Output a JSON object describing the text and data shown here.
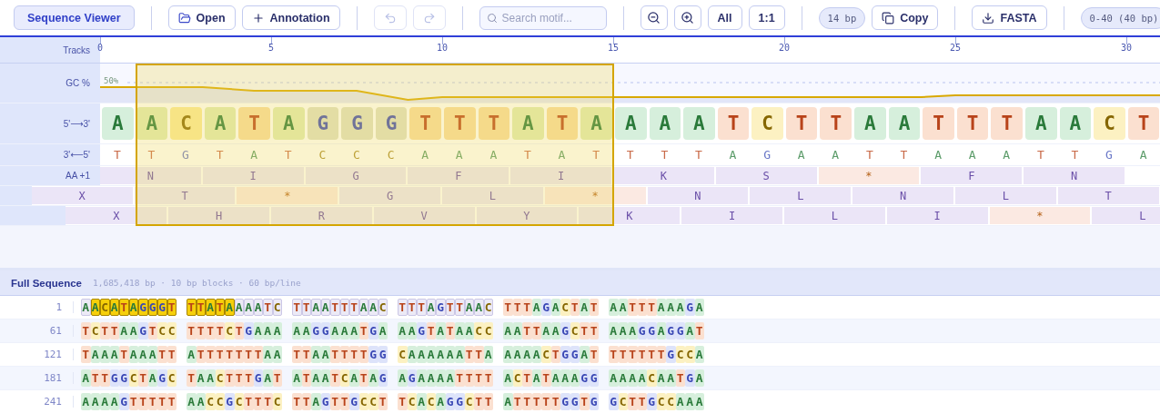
{
  "toolbar": {
    "title": {
      "label": "Sequence Viewer",
      "selected": true
    },
    "file_buttons": [
      {
        "kind": "open",
        "label": "Open"
      },
      {
        "kind": "add",
        "label": "Annotation"
      }
    ],
    "history": [
      {
        "kind": "undo",
        "disabled": true
      },
      {
        "kind": "redo",
        "disabled": true
      }
    ],
    "search": {
      "placeholder": "Search motif..."
    },
    "zoom": [
      {
        "kind": "zoom-out"
      },
      {
        "kind": "zoom-in"
      },
      {
        "kind": "text",
        "label": "All"
      },
      {
        "kind": "text",
        "label": "1:1"
      }
    ],
    "selection_length": "14 bp",
    "copy": "Copy",
    "export": "FASTA",
    "range": "0-40 (40 bp)"
  },
  "tracks": {
    "label": "Tracks",
    "ruler": [
      "0",
      "5",
      "10",
      "15",
      "20",
      "25",
      "30"
    ],
    "gc": {
      "label": "GC %",
      "midline": "50%"
    },
    "forward": {
      "label": "5'⟶3'",
      "bases": [
        {
          "base": "A",
          "selected": false
        },
        {
          "base": "A",
          "selected": true
        },
        {
          "base": "C",
          "selected": true
        },
        {
          "base": "A",
          "selected": true
        },
        {
          "base": "T",
          "selected": true
        },
        {
          "base": "A",
          "selected": true
        },
        {
          "base": "G",
          "selected": true
        },
        {
          "base": "G",
          "selected": true
        },
        {
          "base": "G",
          "selected": true
        },
        {
          "base": "T",
          "selected": true
        },
        {
          "base": "T",
          "selected": true
        },
        {
          "base": "T",
          "selected": true
        },
        {
          "base": "A",
          "selected": true
        },
        {
          "base": "T",
          "selected": true
        },
        {
          "base": "A",
          "selected": true
        },
        {
          "base": "A",
          "selected": false
        },
        {
          "base": "A",
          "selected": false
        },
        {
          "base": "A",
          "selected": false
        },
        {
          "base": "T",
          "selected": false
        },
        {
          "base": "C",
          "selected": false
        },
        {
          "base": "T",
          "selected": false
        },
        {
          "base": "T",
          "selected": false
        },
        {
          "base": "A",
          "selected": false
        },
        {
          "base": "A",
          "selected": false
        },
        {
          "base": "T",
          "selected": false
        },
        {
          "base": "T",
          "selected": false
        },
        {
          "base": "T",
          "selected": false
        },
        {
          "base": "A",
          "selected": false
        },
        {
          "base": "A",
          "selected": false
        },
        {
          "base": "C",
          "selected": false
        },
        {
          "base": "T",
          "selected": false
        }
      ]
    },
    "reverse": {
      "label": "3'⟵5'",
      "bases": [
        "T",
        "T",
        "G",
        "T",
        "A",
        "T",
        "C",
        "C",
        "C",
        "A",
        "A",
        "A",
        "T",
        "A",
        "T",
        "T",
        "T",
        "T",
        "A",
        "G",
        "A",
        "A",
        "T",
        "T",
        "A",
        "A",
        "A",
        "T",
        "T",
        "G",
        "A"
      ]
    },
    "frames": [
      {
        "label": "AA +1",
        "kind": "aligned",
        "codons": [
          {
            "aa": "N",
            "stop": false
          },
          {
            "aa": "I",
            "stop": false
          },
          {
            "aa": "G",
            "stop": false
          },
          {
            "aa": "F",
            "stop": false
          },
          {
            "aa": "I",
            "stop": false
          },
          {
            "aa": "K",
            "stop": false
          },
          {
            "aa": "S",
            "stop": false
          },
          {
            "aa": "*",
            "stop": true
          },
          {
            "aa": "F",
            "stop": false
          },
          {
            "aa": "N",
            "stop": false
          }
        ]
      },
      {
        "kind": "shifted",
        "codons": [
          {
            "aa": "X",
            "stop": false
          },
          {
            "aa": "T",
            "stop": false
          },
          {
            "aa": "*",
            "stop": true
          },
          {
            "aa": "G",
            "stop": false
          },
          {
            "aa": "L",
            "stop": false
          },
          {
            "aa": "*",
            "stop": true
          },
          {
            "aa": "N",
            "stop": false
          },
          {
            "aa": "L",
            "stop": false
          },
          {
            "aa": "N",
            "stop": false
          },
          {
            "aa": "L",
            "stop": false
          },
          {
            "aa": "T",
            "stop": false
          }
        ]
      },
      {
        "kind": "offset",
        "codons": [
          {
            "aa": "X",
            "stop": false
          },
          {
            "aa": "H",
            "stop": false
          },
          {
            "aa": "R",
            "stop": false
          },
          {
            "aa": "V",
            "stop": false
          },
          {
            "aa": "Y",
            "stop": false
          },
          {
            "aa": "K",
            "stop": false
          },
          {
            "aa": "I",
            "stop": false
          },
          {
            "aa": "L",
            "stop": false
          },
          {
            "aa": "I",
            "stop": false
          },
          {
            "aa": "*",
            "stop": true
          },
          {
            "aa": "L",
            "stop": false
          }
        ]
      }
    ]
  },
  "full_sequence": {
    "title": "Full Sequence",
    "info": "1,685,418 bp · 10 bp blocks · 60 bp/line",
    "rows": [
      {
        "number": "1",
        "blocks": [
          [
            {
              "text": "A",
              "in_view": true,
              "selected": false
            },
            {
              "text": "ACATAGGGT",
              "in_view": true,
              "selected": true
            }
          ],
          [
            {
              "text": "TTATA",
              "in_view": true,
              "selected": true
            },
            {
              "text": "AAATC",
              "in_view": true,
              "selected": false
            }
          ],
          [
            {
              "text": "TTAATTTAAC",
              "in_view": true,
              "selected": false
            }
          ],
          [
            {
              "text": "TTTAGTTAAC",
              "in_view": true,
              "selected": false
            }
          ],
          [
            {
              "text": "TTTAGACTAT",
              "in_view": false,
              "selected": false
            }
          ],
          [
            {
              "text": "AATTTAAAGA",
              "in_view": false,
              "selected": false
            }
          ]
        ]
      },
      {
        "number": "61",
        "blocks": [
          [
            {
              "text": "TCTTAAGTCC",
              "in_view": false,
              "selected": false
            }
          ],
          [
            {
              "text": "TTTTCTGAAA",
              "in_view": false,
              "selected": false
            }
          ],
          [
            {
              "text": "AAGGAAATGA",
              "in_view": false,
              "selected": false
            }
          ],
          [
            {
              "text": "AAGTATAACC",
              "in_view": false,
              "selected": false
            }
          ],
          [
            {
              "text": "AATTAAGCTT",
              "in_view": false,
              "selected": false
            }
          ],
          [
            {
              "text": "AAAGGAGGAT",
              "in_view": false,
              "selected": false
            }
          ]
        ]
      },
      {
        "number": "121",
        "blocks": [
          [
            {
              "text": "TAAATAAATT",
              "in_view": false,
              "selected": false
            }
          ],
          [
            {
              "text": "ATTTTTTTAA",
              "in_view": false,
              "selected": false
            }
          ],
          [
            {
              "text": "TTAATTTTGG",
              "in_view": false,
              "selected": false
            }
          ],
          [
            {
              "text": "CAAAAAATTA",
              "in_view": false,
              "selected": false
            }
          ],
          [
            {
              "text": "AAAACTGGAT",
              "in_view": false,
              "selected": false
            }
          ],
          [
            {
              "text": "TTTTTTGCCA",
              "in_view": false,
              "selected": false
            }
          ]
        ]
      },
      {
        "number": "181",
        "blocks": [
          [
            {
              "text": "ATTGGCTAGC",
              "in_view": false,
              "selected": false
            }
          ],
          [
            {
              "text": "TAACTTTGAT",
              "in_view": false,
              "selected": false
            }
          ],
          [
            {
              "text": "ATAATCATAG",
              "in_view": false,
              "selected": false
            }
          ],
          [
            {
              "text": "AGAAAATTTT",
              "in_view": false,
              "selected": false
            }
          ],
          [
            {
              "text": "ACTATAAAGG",
              "in_view": false,
              "selected": false
            }
          ],
          [
            {
              "text": "AAAACAATGA",
              "in_view": false,
              "selected": false
            }
          ]
        ]
      },
      {
        "number": "241",
        "blocks": [
          [
            {
              "text": "AAAAGTTTTT",
              "in_view": false,
              "selected": false
            }
          ],
          [
            {
              "text": "AACCGCTTTC",
              "in_view": false,
              "selected": false
            }
          ],
          [
            {
              "text": "TTAGTTGCCT",
              "in_view": false,
              "selected": false
            }
          ],
          [
            {
              "text": "TCACAGGCTT",
              "in_view": false,
              "selected": false
            }
          ],
          [
            {
              "text": "ATTTTTGGTG",
              "in_view": false,
              "selected": false
            }
          ],
          [
            {
              "text": "GCTTGCCAAA",
              "in_view": false,
              "selected": false
            }
          ]
        ]
      }
    ]
  }
}
